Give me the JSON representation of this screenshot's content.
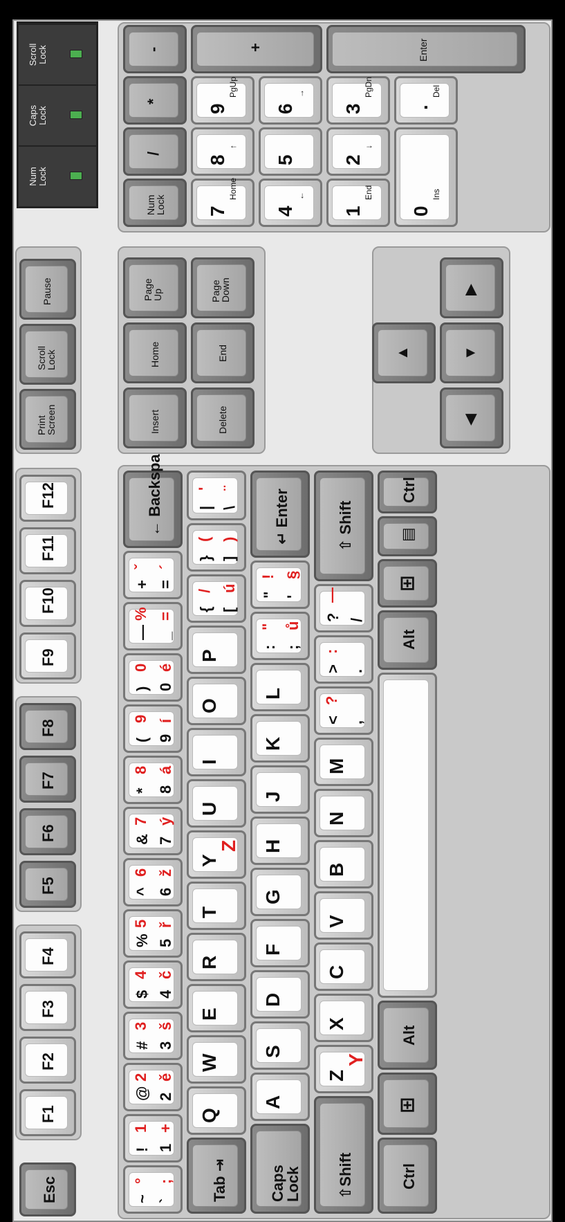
{
  "keyboard": {
    "function_row": {
      "esc": "Esc",
      "f": [
        "F1",
        "F2",
        "F3",
        "F4",
        "F5",
        "F6",
        "F7",
        "F8",
        "F9",
        "F10",
        "F11",
        "F12"
      ],
      "print_screen": [
        "Print",
        "Screen"
      ],
      "scroll_lock": [
        "Scroll",
        "Lock"
      ],
      "pause": "Pause"
    },
    "leds": [
      {
        "line1": "Num",
        "line2": "Lock"
      },
      {
        "line1": "Caps",
        "line2": "Lock"
      },
      {
        "line1": "Scroll",
        "line2": "Lock"
      }
    ],
    "number_row": [
      {
        "top": "~",
        "bottom": "`",
        "red_top": "°",
        "red_bottom": ";"
      },
      {
        "top": "!",
        "bottom": "1",
        "red_top": "1",
        "red_bottom": "+"
      },
      {
        "top": "@",
        "bottom": "2",
        "red_top": "2",
        "red_bottom": "ě"
      },
      {
        "top": "#",
        "bottom": "3",
        "red_top": "3",
        "red_bottom": "š"
      },
      {
        "top": "$",
        "bottom": "4",
        "red_top": "4",
        "red_bottom": "č"
      },
      {
        "top": "%",
        "bottom": "5",
        "red_top": "5",
        "red_bottom": "ř"
      },
      {
        "top": "^",
        "bottom": "6",
        "red_top": "6",
        "red_bottom": "ž"
      },
      {
        "top": "&",
        "bottom": "7",
        "red_top": "7",
        "red_bottom": "ý"
      },
      {
        "top": "*",
        "bottom": "8",
        "red_top": "8",
        "red_bottom": "á"
      },
      {
        "top": "(",
        "bottom": "9",
        "red_top": "9",
        "red_bottom": "í"
      },
      {
        "top": ")",
        "bottom": "0",
        "red_top": "0",
        "red_bottom": "é"
      },
      {
        "top": "—",
        "bottom": "_",
        "red_top": "%",
        "red_bottom": "="
      },
      {
        "top": "+",
        "bottom": "=",
        "red_top": "ˇ",
        "red_bottom": "´"
      }
    ],
    "backspace": "Backspace",
    "tab": "Tab",
    "qwerty_row": [
      {
        "main": "Q"
      },
      {
        "main": "W"
      },
      {
        "main": "E"
      },
      {
        "main": "R"
      },
      {
        "main": "T"
      },
      {
        "main": "Y",
        "red": "Z"
      },
      {
        "main": "U"
      },
      {
        "main": "I"
      },
      {
        "main": "O"
      },
      {
        "main": "P"
      },
      {
        "main": "{",
        "sub": "[",
        "red_top": "/",
        "red_bottom": "ú"
      },
      {
        "main": "}",
        "sub": "]",
        "red_top": "(",
        "red_bottom": ")"
      },
      {
        "main": "|",
        "sub": "\\",
        "red_top": "'",
        "red_bottom": "¨"
      }
    ],
    "caps_lock": [
      "Caps",
      "Lock"
    ],
    "asdf_row": [
      {
        "main": "A"
      },
      {
        "main": "S"
      },
      {
        "main": "D"
      },
      {
        "main": "F"
      },
      {
        "main": "G"
      },
      {
        "main": "H"
      },
      {
        "main": "J"
      },
      {
        "main": "K"
      },
      {
        "main": "L"
      },
      {
        "main": ":",
        "sub": ";",
        "red_top": "\"",
        "red_bottom": "ů"
      },
      {
        "main": "\"",
        "sub": "'",
        "red_top": "!",
        "red_bottom": "§"
      }
    ],
    "enter": "Enter",
    "shift": "Shift",
    "zxcv_row": [
      {
        "main": "Z",
        "red": "Y"
      },
      {
        "main": "X"
      },
      {
        "main": "C"
      },
      {
        "main": "V"
      },
      {
        "main": "B"
      },
      {
        "main": "N"
      },
      {
        "main": "M"
      },
      {
        "main": "<",
        "sub": ",",
        "red_top": "?",
        "red_bottom": ""
      },
      {
        "main": ">",
        "sub": ".",
        "red_top": ":",
        "red_bottom": ""
      },
      {
        "main": "?",
        "sub": "/",
        "red_top": "—",
        "red_bottom": ""
      }
    ],
    "ctrl": "Ctrl",
    "alt": "Alt",
    "nav": {
      "insert": "Insert",
      "home": "Home",
      "page_up": [
        "Page",
        "Up"
      ],
      "delete": "Delete",
      "end": "End",
      "page_down": [
        "Page",
        "Down"
      ]
    },
    "numpad": {
      "num_lock": [
        "Num",
        "Lock"
      ],
      "divide": "/",
      "multiply": "*",
      "minus": "-",
      "plus": "+",
      "enter": "Enter",
      "keys": [
        {
          "main": "7",
          "sub": "Home"
        },
        {
          "main": "8",
          "sub": "↑"
        },
        {
          "main": "9",
          "sub": "PgUp"
        },
        {
          "main": "4",
          "sub": "←"
        },
        {
          "main": "5",
          "sub": ""
        },
        {
          "main": "6",
          "sub": "→"
        },
        {
          "main": "1",
          "sub": "End"
        },
        {
          "main": "2",
          "sub": "↓"
        },
        {
          "main": "3",
          "sub": "PgDn"
        }
      ],
      "zero": {
        "main": "0",
        "sub": "Ins"
      },
      "dot": {
        "main": ".",
        "sub": "Del"
      }
    }
  }
}
